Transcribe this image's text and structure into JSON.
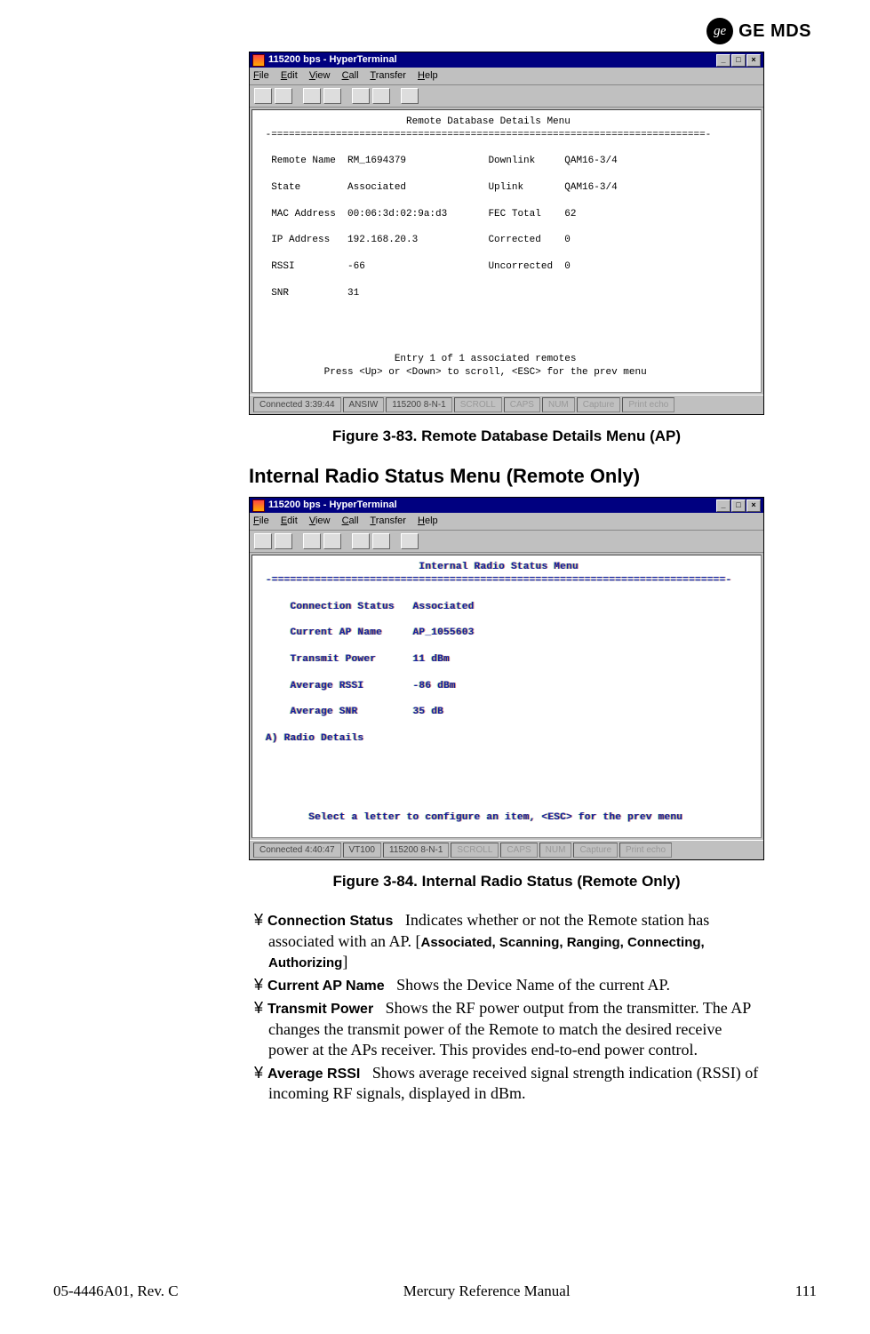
{
  "brand": {
    "logo_text": "ge",
    "name": "GE MDS"
  },
  "figure1": {
    "caption": "Figure 3-83. Remote Database Details Menu (AP)",
    "window_title": "115200 bps - HyperTerminal",
    "menus": [
      "File",
      "Edit",
      "View",
      "Call",
      "Transfer",
      "Help"
    ],
    "screen_title": "Remote Database Details Menu",
    "rows_left": [
      [
        "Remote Name",
        "RM_1694379"
      ],
      [
        "State",
        "Associated"
      ],
      [
        "MAC Address",
        "00:06:3d:02:9a:d3"
      ],
      [
        "IP Address",
        "192.168.20.3"
      ],
      [
        "RSSI",
        "-66"
      ],
      [
        "SNR",
        "31"
      ]
    ],
    "rows_right": [
      [
        "Downlink",
        "QAM16-3/4"
      ],
      [
        "Uplink",
        "QAM16-3/4"
      ],
      [
        "FEC Total",
        "62"
      ],
      [
        "Corrected",
        "0"
      ],
      [
        "Uncorrected",
        "0"
      ]
    ],
    "footer_lines": [
      "Entry 1 of 1 associated remotes",
      "Press <Up> or <Down> to scroll, <ESC> for the prev menu"
    ],
    "status": [
      "Connected 3:39:44",
      "ANSIW",
      "115200 8-N-1",
      "SCROLL",
      "CAPS",
      "NUM",
      "Capture",
      "Print echo"
    ]
  },
  "section_heading": "Internal Radio Status Menu (Remote Only)",
  "figure2": {
    "caption": "Figure 3-84. Internal Radio Status (Remote Only)",
    "window_title": "115200 bps - HyperTerminal",
    "menus": [
      "File",
      "Edit",
      "View",
      "Call",
      "Transfer",
      "Help"
    ],
    "screen_title": "Internal Radio Status Menu",
    "rows": [
      [
        "Connection Status",
        "Associated"
      ],
      [
        "Current AP Name",
        "AP_1055603"
      ],
      [
        "Transmit Power",
        "11 dBm"
      ],
      [
        "Average RSSI",
        "-86 dBm"
      ],
      [
        "Average SNR",
        "35 dB"
      ]
    ],
    "option_line": "A) Radio Details",
    "footer_line": "Select a letter to configure an item, <ESC> for the prev menu",
    "status": [
      "Connected 4:40:47",
      "VT100",
      "115200 8-N-1",
      "SCROLL",
      "CAPS",
      "NUM",
      "Capture",
      "Print echo"
    ]
  },
  "bullets": {
    "b1_label": "Connection Status",
    "b1_text_a": "Indicates whether or not the Remote station has associated with an AP. [",
    "b1_opts": "Associated, Scanning, Ranging, Connecting, Authorizing",
    "b1_text_b": "]",
    "b2_label": "Current AP Name",
    "b2_text": "Shows the Device Name of the current AP.",
    "b3_label": "Transmit Power",
    "b3_text": "Shows the RF power output from the transmitter. The AP changes the transmit power of the Remote to match the desired receive power at the APs receiver. This provides end-to-end power control.",
    "b4_label": "Average RSSI",
    "b4_text": "Shows average received signal strength indication (RSSI) of incoming RF signals, displayed in dBm."
  },
  "footer": {
    "left": "05-4446A01, Rev. C",
    "center": "Mercury Reference Manual",
    "right": "111"
  }
}
